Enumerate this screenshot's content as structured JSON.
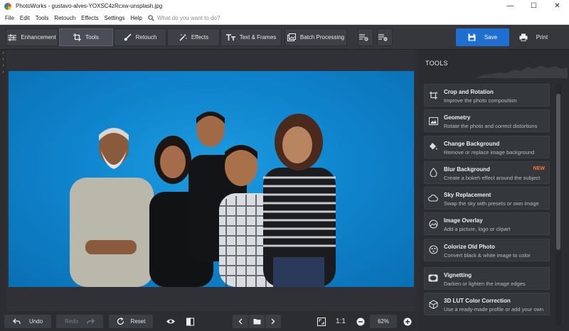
{
  "window": {
    "title": "PhotoWorks - gustavo-alves-YOXSC4zRcxw-unsplash.jpg",
    "minimize_label": "—",
    "maximize_label": "☐",
    "close_label": "✕"
  },
  "menu": {
    "items": [
      "File",
      "Edit",
      "Tools",
      "Retouch",
      "Effects",
      "Settings",
      "Help"
    ],
    "search_placeholder": "What do you want to do?"
  },
  "toolbar": {
    "tabs": [
      "Enhancement",
      "Tools",
      "Retouch",
      "Effects",
      "Text & Frames"
    ],
    "active_tab": "Tools",
    "batch_label": "Batch Processing",
    "save_label": "Save",
    "print_label": "Print"
  },
  "panel": {
    "title": "TOOLS",
    "tools": [
      {
        "name": "Crop and Rotation",
        "desc": "Improve the photo composition",
        "icon": "crop-rotate-icon"
      },
      {
        "name": "Geometry",
        "desc": "Rotate the photo and correct distortions",
        "icon": "geometry-icon"
      },
      {
        "name": "Change Background",
        "desc": "Remove or replace image background",
        "icon": "paint-bucket-icon"
      },
      {
        "name": "Blur Background",
        "desc": "Create a bokeh effect around the subject",
        "icon": "blur-icon",
        "badge": "NEW"
      },
      {
        "name": "Sky Replacement",
        "desc": "Swap the sky with presets or own image",
        "icon": "cloud-icon"
      },
      {
        "name": "Image Overlay",
        "desc": "Add a picture, logo or clipart",
        "icon": "overlay-icon"
      },
      {
        "name": "Colorize Old Photo",
        "desc": "Convert black & white image to color",
        "icon": "colorize-icon"
      },
      {
        "name": "Vignetting",
        "desc": "Darken or lighten the image edges",
        "icon": "vignette-icon"
      },
      {
        "name": "3D LUT Color Correction",
        "desc": "Use a ready-made profile or add your own",
        "icon": "lut-cube-icon"
      }
    ],
    "badge_color": "#ff7a2d"
  },
  "bottom": {
    "undo_label": "Undo",
    "redo_label": "Redo",
    "reset_label": "Reset",
    "ratio_label": "1:1",
    "zoom_value": "62%"
  },
  "colors": {
    "accent": "#1f6fd1",
    "photo_background": "#1192d8"
  }
}
